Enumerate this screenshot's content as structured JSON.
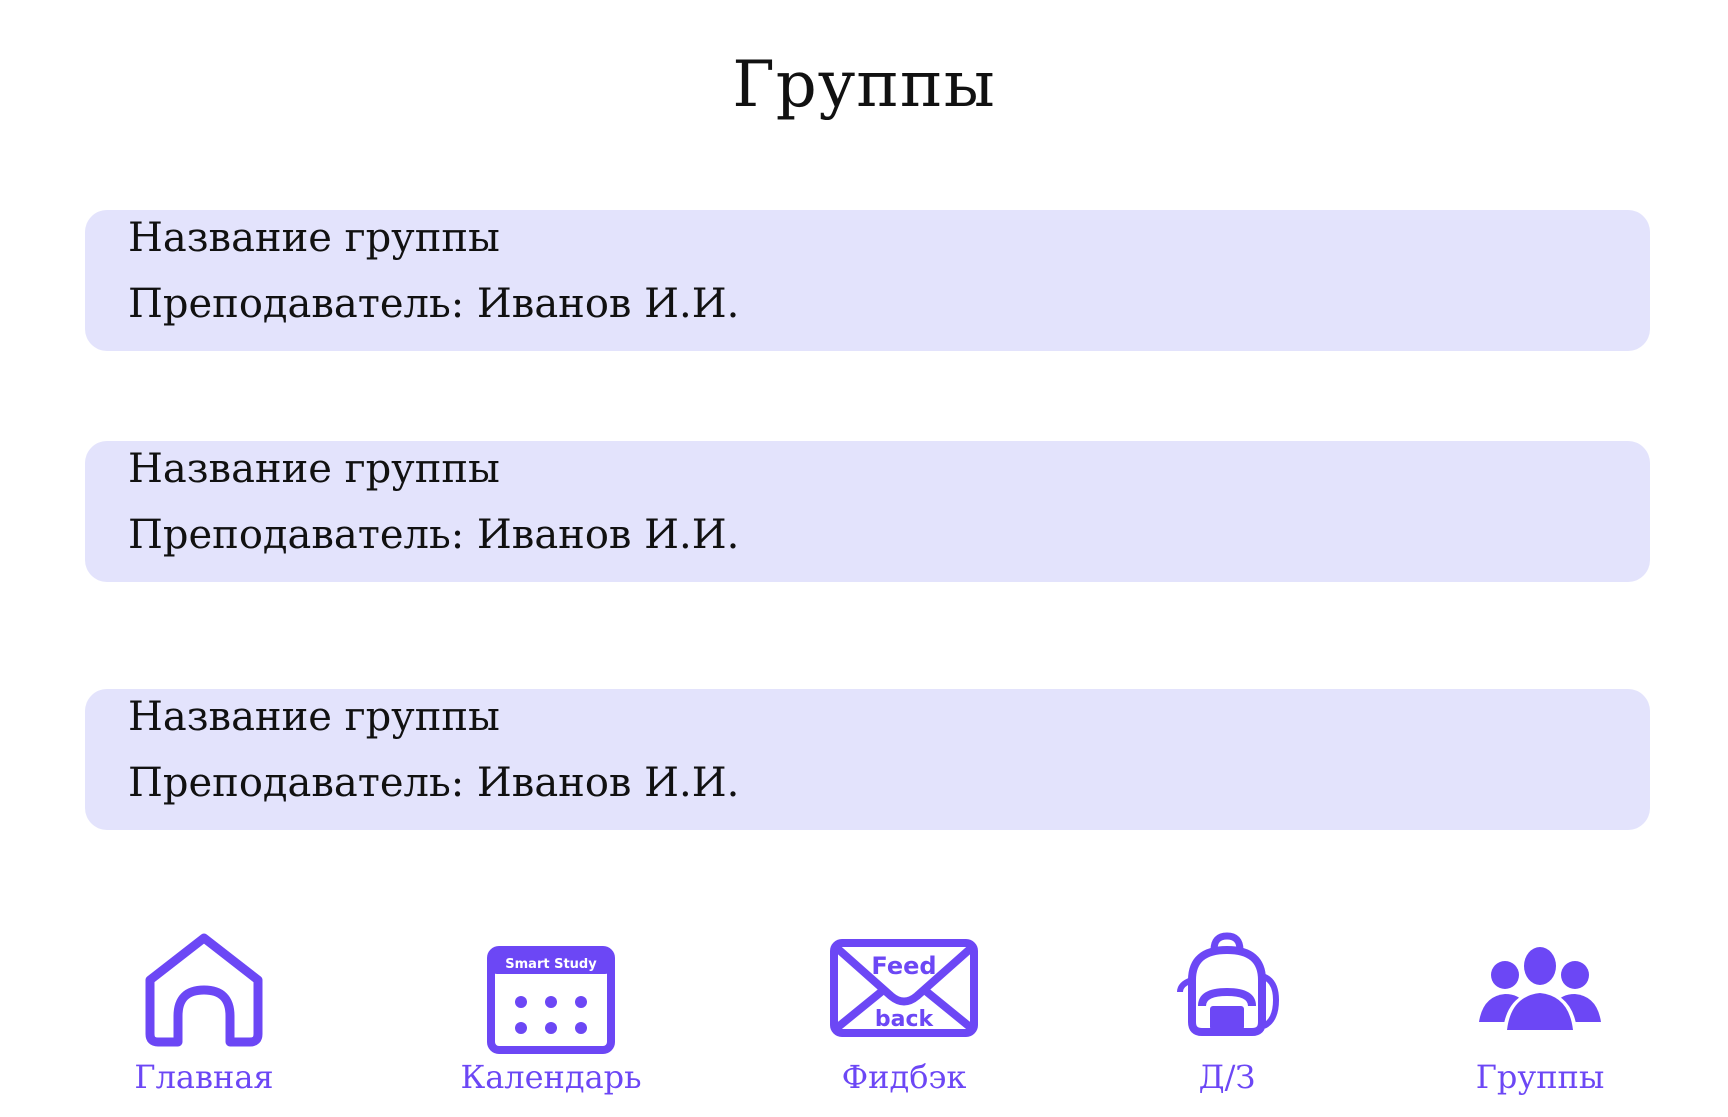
{
  "page": {
    "title": "Группы"
  },
  "groups": [
    {
      "name": "Название группы",
      "teacher": "Преподаватель: Иванов И.И."
    },
    {
      "name": "Название группы",
      "teacher": "Преподаватель: Иванов И.И."
    },
    {
      "name": "Название группы",
      "teacher": "Преподаватель: Иванов И.И."
    }
  ],
  "nav": {
    "home": {
      "label": "Главная",
      "icon": "home-icon"
    },
    "calendar": {
      "label": "Календарь",
      "icon": "calendar-icon",
      "icon_text": "Smart Study"
    },
    "feedback": {
      "label": "Фидбэк",
      "icon": "feedback-envelope-icon",
      "icon_text_top": "Feed",
      "icon_text_bottom": "back"
    },
    "homework": {
      "label": "Д/З",
      "icon": "backpack-icon"
    },
    "groups": {
      "label": "Группы",
      "icon": "users-icon"
    }
  },
  "colors": {
    "accent": "#6c47f5",
    "card_background": "#e3e3fc",
    "text": "#111111",
    "background": "#ffffff"
  }
}
